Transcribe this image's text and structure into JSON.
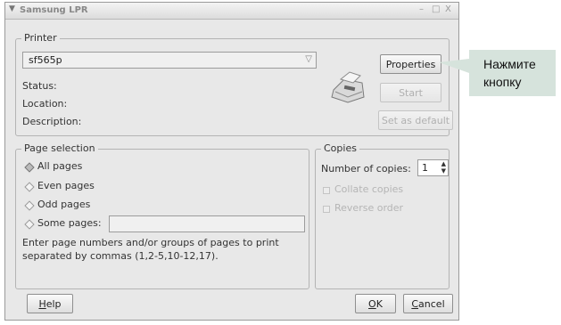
{
  "window": {
    "title": "Samsung LPR",
    "controls": {
      "minimize": "–",
      "maximize": "□",
      "close": "X"
    }
  },
  "printer": {
    "group_label": "Printer",
    "selected": "sf565p",
    "status_label": "Status:",
    "location_label": "Location:",
    "description_label": "Description:",
    "properties_button": "Properties",
    "start_button": "Start",
    "set_default_button": "Set as default"
  },
  "page_selection": {
    "group_label": "Page selection",
    "options": [
      "All pages",
      "Even pages",
      "Odd pages",
      "Some pages:"
    ],
    "selected_index": 0,
    "hint": "Enter page numbers and/or groups of pages to print separated by commas (1,2-5,10-12,17)."
  },
  "copies": {
    "group_label": "Copies",
    "number_label": "Number of copies:",
    "number_value": "1",
    "collate_label": "Collate copies",
    "reverse_label": "Reverse order"
  },
  "footer": {
    "help_h": "H",
    "help_rest": "elp",
    "ok_o": "O",
    "ok_rest": "K",
    "cancel_c": "C",
    "cancel_rest": "ancel"
  },
  "callout": {
    "line1": "Нажмите",
    "line2": "кнопку",
    "color": "#d6e3dc"
  }
}
